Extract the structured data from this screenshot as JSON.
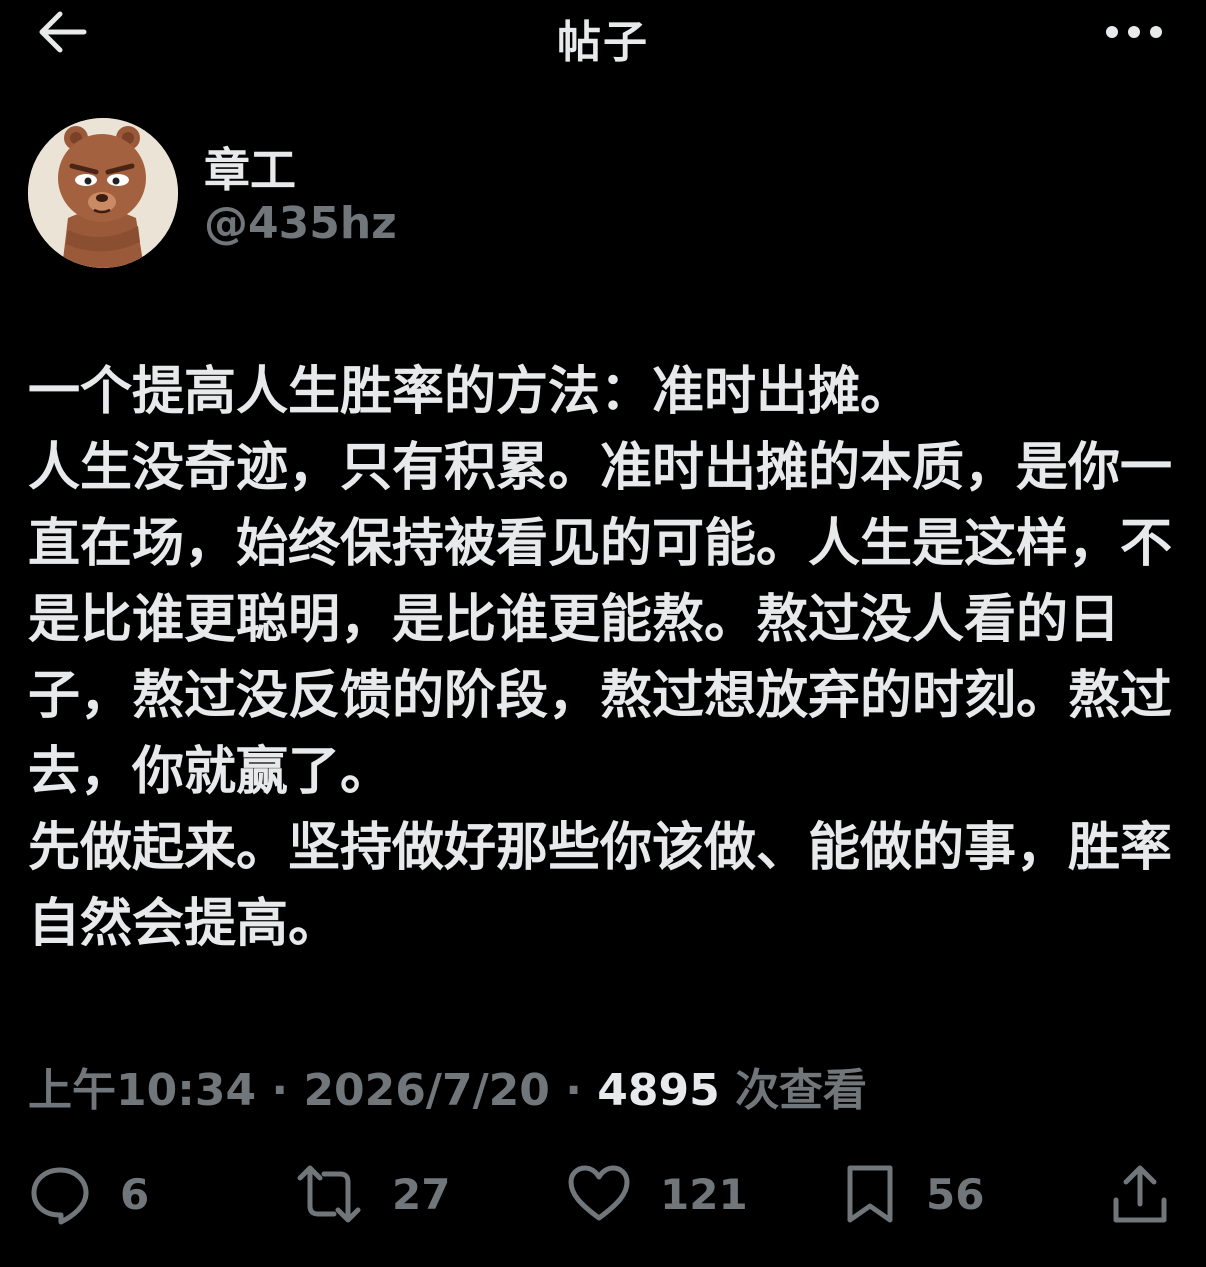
{
  "header": {
    "title": "帖子",
    "back_icon": "arrow-left-icon",
    "more_icon": "more-horizontal-icon"
  },
  "author": {
    "display_name": "章工",
    "handle": "@435hz",
    "avatar": "cartoon-bear-avatar"
  },
  "post": {
    "paragraphs": [
      "一个提高人生胜率的方法：准时出摊。",
      "人生没奇迹，只有积累。准时出摊的本质，是你一直在场，始终保持被看见的可能。人生是这样，不是比谁更聪明，是比谁更能熬。熬过没人看的日子，熬过没反馈的阶段，熬过想放弃的时刻。熬过去，你就赢了。",
      "先做起来。坚持做好那些你该做、能做的事，胜率自然会提高。"
    ]
  },
  "meta": {
    "time": "上午10:34",
    "dot": "·",
    "date": "2026/7/20",
    "views_count": "4895",
    "views_label": "次查看"
  },
  "actions": {
    "replies": "6",
    "reposts": "27",
    "likes": "121",
    "bookmarks": "56"
  },
  "colors": {
    "background": "#000000",
    "text_primary": "#e7e9ea",
    "text_secondary": "#71767b"
  }
}
